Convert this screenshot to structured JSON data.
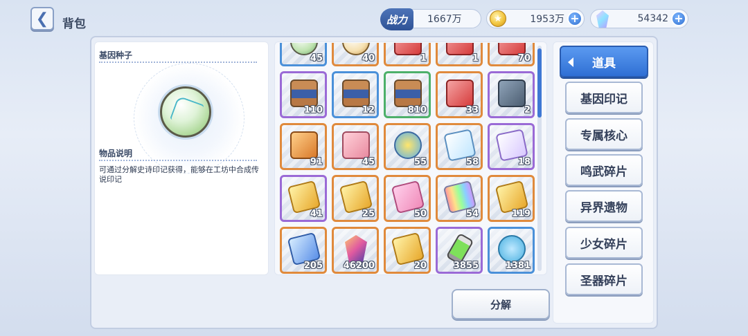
{
  "header": {
    "title": "背包",
    "power_label": "战力",
    "power_value": "1667万",
    "gold_amount": "1953万",
    "gem_amount": "54342",
    "plus": "+"
  },
  "detail": {
    "item_name": "基因种子",
    "desc_heading": "物品说明",
    "desc_text": "可通过分解史诗印记获得，能够在工坊中合成传说印记"
  },
  "grid": {
    "items": [
      {
        "count": "45",
        "rarity": "r-blue",
        "icon": "orb-s"
      },
      {
        "count": "40",
        "rarity": "r-orange",
        "icon": "gold-s"
      },
      {
        "count": "1",
        "rarity": "r-orange",
        "icon": "cube-red"
      },
      {
        "count": "1",
        "rarity": "r-orange",
        "icon": "cube-red"
      },
      {
        "count": "70",
        "rarity": "r-orange",
        "icon": "cube-red"
      },
      {
        "count": "110",
        "rarity": "r-purple",
        "icon": "chest"
      },
      {
        "count": "12",
        "rarity": "r-blue",
        "icon": "chest"
      },
      {
        "count": "810",
        "rarity": "r-green",
        "icon": "chest"
      },
      {
        "count": "33",
        "rarity": "r-orange",
        "icon": "cube-red"
      },
      {
        "count": "2",
        "rarity": "r-purple",
        "icon": "dna"
      },
      {
        "count": "91",
        "rarity": "r-orange",
        "icon": "cube-orange"
      },
      {
        "count": "45",
        "rarity": "r-orange",
        "icon": "gift"
      },
      {
        "count": "55",
        "rarity": "r-orange",
        "icon": "stars"
      },
      {
        "count": "58",
        "rarity": "r-orange",
        "icon": "ticket-blue"
      },
      {
        "count": "18",
        "rarity": "r-purple",
        "icon": "ticket-purple"
      },
      {
        "count": "41",
        "rarity": "r-purple",
        "icon": "card-gold"
      },
      {
        "count": "25",
        "rarity": "r-orange",
        "icon": "card-gold"
      },
      {
        "count": "50",
        "rarity": "r-orange",
        "icon": "card-pink"
      },
      {
        "count": "54",
        "rarity": "r-orange",
        "icon": "card-rainbow"
      },
      {
        "count": "119",
        "rarity": "r-orange",
        "icon": "card-gold"
      },
      {
        "count": "205",
        "rarity": "r-orange",
        "icon": "card-blue"
      },
      {
        "count": "46200",
        "rarity": "r-orange",
        "icon": "crystal"
      },
      {
        "count": "20",
        "rarity": "r-orange",
        "icon": "card-gold"
      },
      {
        "count": "3855",
        "rarity": "r-purple",
        "icon": "tube"
      },
      {
        "count": "1381",
        "rarity": "r-blue",
        "icon": "candy"
      }
    ]
  },
  "decompose_label": "分解",
  "categories": {
    "active": "道具",
    "items": [
      "基因印记",
      "专属核心",
      "鸣武碎片",
      "异界遗物",
      "少女碎片",
      "圣器碎片"
    ]
  }
}
